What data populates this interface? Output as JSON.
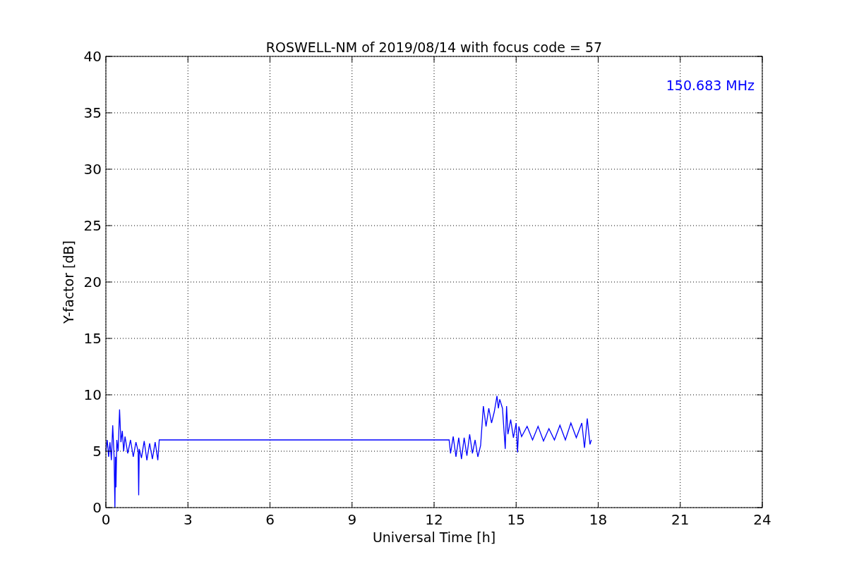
{
  "chart_data": {
    "type": "line",
    "title": "ROSWELL-NM of 2019/08/14 with focus code = 57",
    "xlabel": "Universal Time [h]",
    "ylabel": "Y-factor [dB]",
    "xlim": [
      0,
      24
    ],
    "ylim": [
      0,
      40
    ],
    "xticks": [
      0,
      3,
      6,
      9,
      12,
      15,
      18,
      21,
      24
    ],
    "yticks": [
      0,
      5,
      10,
      15,
      20,
      25,
      30,
      35,
      40
    ],
    "x": [
      0,
      0.05,
      0.1,
      0.15,
      0.2,
      0.25,
      0.3,
      0.33,
      0.35,
      0.37,
      0.4,
      0.45,
      0.5,
      0.55,
      0.6,
      0.65,
      0.7,
      0.8,
      0.9,
      1.0,
      1.1,
      1.18,
      1.2,
      1.22,
      1.3,
      1.4,
      1.5,
      1.6,
      1.7,
      1.8,
      1.9,
      1.95,
      2.0,
      12.55,
      12.6,
      12.7,
      12.8,
      12.9,
      13.0,
      13.1,
      13.2,
      13.3,
      13.4,
      13.5,
      13.6,
      13.7,
      13.8,
      13.9,
      14.0,
      14.1,
      14.2,
      14.3,
      14.35,
      14.4,
      14.5,
      14.6,
      14.65,
      14.7,
      14.8,
      14.9,
      15.0,
      15.05,
      15.1,
      15.2,
      15.4,
      15.6,
      15.8,
      16.0,
      16.2,
      16.4,
      16.6,
      16.8,
      17.0,
      17.2,
      17.4,
      17.5,
      17.6,
      17.7,
      17.75
    ],
    "series": [
      {
        "color": "#0000ff",
        "values": [
          5,
          6,
          4.5,
          5.8,
          4.2,
          7.3,
          4.6,
          0,
          4.5,
          1.8,
          6,
          5,
          8.7,
          5.8,
          6.8,
          5,
          6.3,
          4.8,
          6,
          4.5,
          5.8,
          5,
          1.1,
          5.2,
          4.4,
          5.9,
          4.2,
          5.7,
          4.3,
          5.8,
          4.2,
          6,
          6,
          6,
          4.8,
          6.3,
          4.5,
          6.2,
          4.3,
          6.2,
          4.6,
          6.5,
          4.8,
          6,
          4.5,
          5.5,
          9,
          7.2,
          8.8,
          7.5,
          8.5,
          9.9,
          8.8,
          9.6,
          8.8,
          5.2,
          9,
          6.5,
          7.8,
          6.2,
          7.5,
          4.9,
          7.2,
          6.3,
          7.2,
          6,
          7.2,
          5.9,
          7,
          6,
          7.3,
          6,
          7.5,
          6.2,
          7.5,
          5.3,
          7.9,
          5.6,
          6
        ]
      }
    ],
    "grid": true,
    "annotations": [
      {
        "text": "150.683 MHz"
      }
    ]
  }
}
